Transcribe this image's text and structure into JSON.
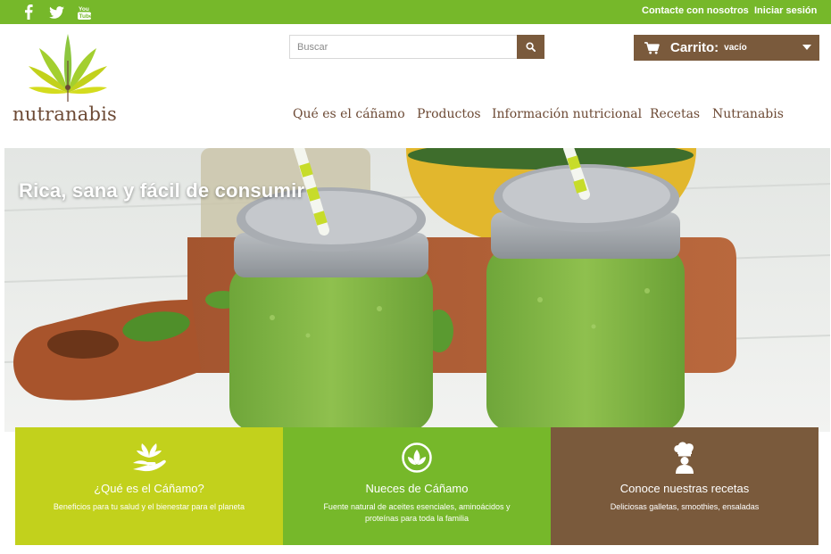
{
  "topbar": {
    "social": [
      "facebook-icon",
      "twitter-icon",
      "youtube-icon"
    ],
    "contact_label": "Contacte con nosotros",
    "login_label": "Iniciar sesión",
    "color": "#76b82a"
  },
  "header": {
    "logo_text": "nutranabis",
    "search_placeholder": "Buscar",
    "cart_label": "Carrito:",
    "cart_status": "vacío"
  },
  "nav": {
    "items": [
      "Qué es el cáñamo",
      "Productos",
      "Información nutricional",
      "Recetas",
      "Nutranabis"
    ]
  },
  "hero": {
    "title": "Rica, sana y fácil de consumir"
  },
  "features": [
    {
      "icon": "hand-plant-icon",
      "title": "¿Qué es el Cáñamo?",
      "description": "Beneficios para tu salud y el bienestar para el planeta",
      "color": "#c2d11c"
    },
    {
      "icon": "leaf-circle-icon",
      "title": "Nueces de Cáñamo",
      "description": "Fuente natural de aceites esenciales, aminoácidos y proteínas para toda la familia",
      "color": "#76b82a"
    },
    {
      "icon": "chef-icon",
      "title": "Conoce nuestras recetas",
      "description": "Deliciosas galletas, smoothies, ensaladas",
      "color": "#7a5a3c"
    }
  ],
  "colors": {
    "brand_green": "#76b82a",
    "brand_brown": "#7a5a3c",
    "lime": "#c2d11c"
  }
}
